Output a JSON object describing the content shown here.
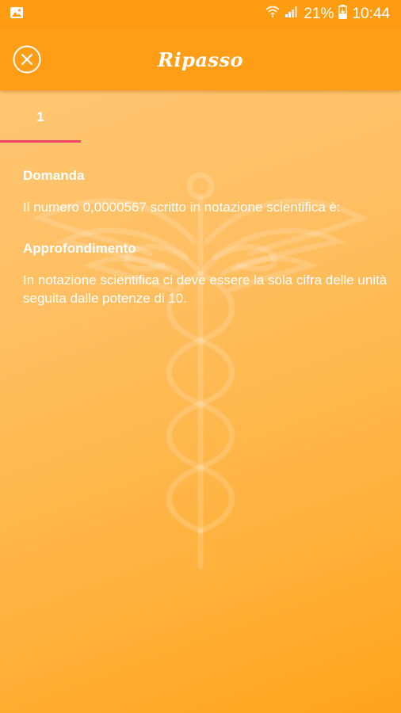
{
  "status_bar": {
    "battery_percent": "21%",
    "time": "10:44"
  },
  "app_bar": {
    "title": "Ripasso",
    "close_icon": "close-circle-icon"
  },
  "tabs": [
    {
      "label": "1",
      "selected": true
    }
  ],
  "content": {
    "question_heading": "Domanda",
    "question_text": "Il numero 0,0000567 scritto in notazione scientifica è:",
    "detail_heading": "Approfondimento",
    "detail_text": "In notazione scientifica ci deve essere la sola cifra delle unità seguita dalle potenze di 10."
  },
  "colors": {
    "app_bar": "#ff9e16",
    "tab_indicator": "#f2456e",
    "background_top": "#ffc978",
    "background_bottom": "#ffa31c"
  }
}
